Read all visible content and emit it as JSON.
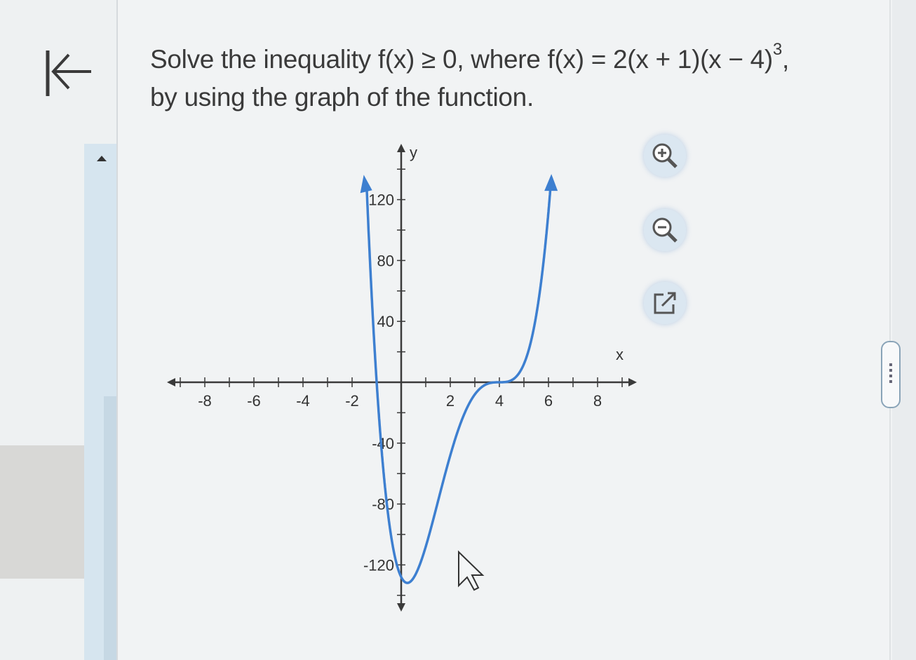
{
  "question": {
    "part1": "Solve the inequality f(x) ≥ 0, where f(x) = 2(x + 1)(x − 4)",
    "exponent": "3",
    "part2": ",",
    "line2": "by using the graph of the function."
  },
  "graph": {
    "x_axis_label": "x",
    "y_axis_label": "y",
    "x_ticks": [
      {
        "value": -8,
        "label": "-8"
      },
      {
        "value": -6,
        "label": "-6"
      },
      {
        "value": -4,
        "label": "-4"
      },
      {
        "value": -2,
        "label": "-2"
      },
      {
        "value": 2,
        "label": "2"
      },
      {
        "value": 4,
        "label": "4"
      },
      {
        "value": 6,
        "label": "6"
      },
      {
        "value": 8,
        "label": "8"
      }
    ],
    "y_ticks": [
      {
        "value": 120,
        "label": "120"
      },
      {
        "value": 80,
        "label": "80"
      },
      {
        "value": 40,
        "label": "40"
      },
      {
        "value": -40,
        "label": "-40"
      },
      {
        "value": -80,
        "label": "-80"
      },
      {
        "value": -120,
        "label": "-120"
      }
    ],
    "curve_color": "#3d7fd0",
    "axis_color": "#3a3a3a"
  },
  "tools": {
    "zoom_in_icon": "zoom-in-icon",
    "zoom_out_icon": "zoom-out-icon",
    "popout_icon": "external-link-icon"
  },
  "nav": {
    "back_icon": "back-to-start-icon",
    "collapse_icon": "caret-up-icon"
  }
}
